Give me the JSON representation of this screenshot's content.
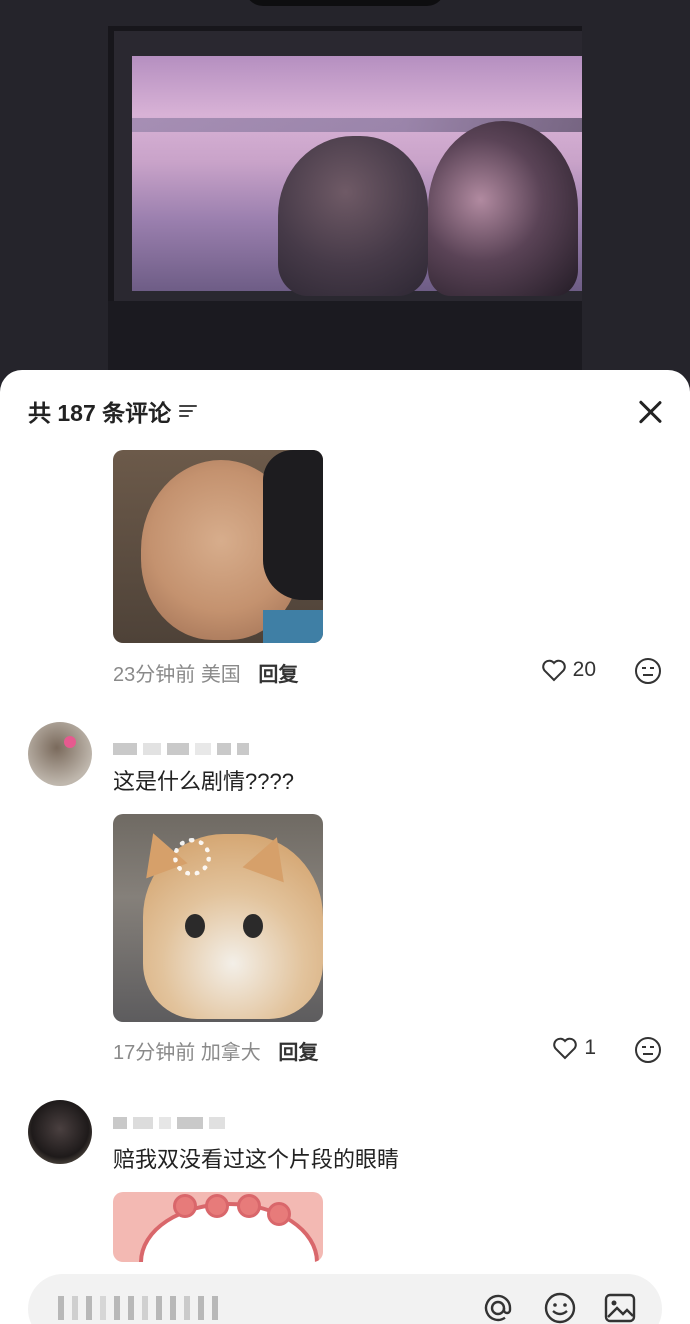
{
  "header": {
    "title": "共 187 条评论"
  },
  "comments": [
    {
      "time": "23分钟前",
      "location": "美国",
      "reply_label": "回复",
      "likes": "20",
      "image": "meme-face-squint"
    },
    {
      "text": "这是什么剧情????",
      "time": "17分钟前",
      "location": "加拿大",
      "reply_label": "回复",
      "likes": "1",
      "image": "meme-cat-loading"
    },
    {
      "text": "赔我双没看过这个片段的眼睛",
      "image": "meme-pink-cartoon"
    }
  ],
  "icons": {
    "filter": "sort-lines-icon",
    "close": "close-icon",
    "like": "heart-outline-icon",
    "dislike": "neutral-face-icon",
    "mention": "at-icon",
    "emoji": "smiley-icon",
    "image": "image-icon"
  },
  "colors": {
    "background": "#25242b",
    "sheet": "#ffffff",
    "meta_text": "#8a8a8a",
    "input_bg": "#f2f2f2"
  }
}
